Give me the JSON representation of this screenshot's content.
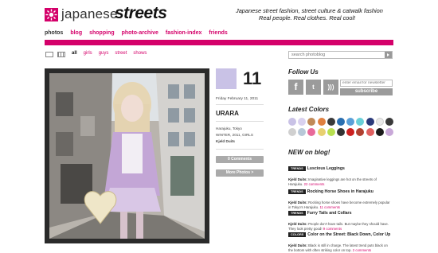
{
  "logo": {
    "part1": "japanese",
    "part2": "streets"
  },
  "tagline": {
    "line1": "Japanese street fashion, street culture & catwalk fashion",
    "line2": "Real people. Real clothes. Real cool!"
  },
  "nav": [
    "photos",
    "blog",
    "shopping",
    "photo-archive",
    "fashion-index",
    "friends"
  ],
  "filters": [
    "all",
    "girls",
    "guys",
    "street",
    "shows"
  ],
  "search": {
    "placeholder": "search photoblog"
  },
  "post": {
    "day": "11",
    "date": "Friday February 11, 2011",
    "title": "URARA",
    "location": "Harajuku, Tokyo",
    "tags": "WINTER, 2011, GIRLS",
    "author": "Kjeld Duits",
    "comments_button": "0 Comments",
    "more_button": "More Photos >"
  },
  "sidebar": {
    "follow_heading": "Follow Us",
    "email_placeholder": "enter email for newsletter",
    "subscribe_label": "subscribe",
    "colors_heading": "Latest Colors",
    "colors": [
      "#c9c2e6",
      "#d9d1ef",
      "#c08a58",
      "#e08040",
      "#3a3a3a",
      "#2a6fb0",
      "#5aa0d8",
      "#6ad0d8",
      "#2a3a7a",
      "#e8e8e8",
      "#3a3a3a",
      "#d0d0d0",
      "#b8c8d8",
      "#e86a9a",
      "#e8d070",
      "#b8e050",
      "#333333",
      "#cc2020",
      "#b04030",
      "#e06060",
      "#1a1a1a",
      "#c8a8d8"
    ],
    "news_heading": "NEW on blog!",
    "news": [
      {
        "category": "TRENDS",
        "title": "Luscious Leggings",
        "author": "Kjeld Duits:",
        "text": "Imaginative leggings are hot on the streets of Harajuku.",
        "comments": "22 comments"
      },
      {
        "category": "TRENDS",
        "title": "Rocking Horse Shoes in Harajuku",
        "author": "Kjeld Duits:",
        "text": "Rocking horse shoes have become extremely popular in Tokyo's Harajuku.",
        "comments": "11 comments"
      },
      {
        "category": "TRENDS",
        "title": "Furry Tails and Collars",
        "author": "Kjeld Duits:",
        "text": "People don't have tails. But maybe they should have. They look pretty good!",
        "comments": "9 comments"
      },
      {
        "category": "COLORS",
        "title": "Color on the Street: Black Down, Color Up",
        "author": "Kjeld Duits:",
        "text": "Black is still in charge. The latest trend puts black on the bottom with often striking color on top.",
        "comments": "2 comments"
      }
    ]
  }
}
